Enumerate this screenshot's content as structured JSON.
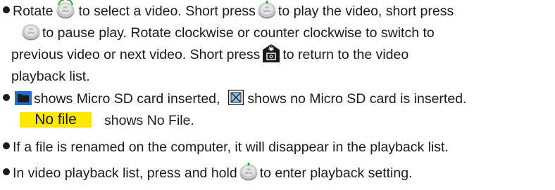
{
  "icons": {
    "knob": "rotary-knob-icon",
    "knob_rotate": "rotary-knob-rotate-icon",
    "home": "home-return-icon",
    "sd_inserted": "sd-card-inserted-icon",
    "sd_missing": "sd-card-missing-icon"
  },
  "colors": {
    "text": "#1a1a1a",
    "highlight": "#ffe800",
    "arrow_green": "#2fa52f"
  },
  "bullet1": {
    "l1_a": "Rotate",
    "l1_b": "to select a video. Short press",
    "l1_c": "to play the video, short press",
    "l2_b": "to pause play. Rotate clockwise or counter clockwise to switch to",
    "l3_a": "previous video or next video. Short press",
    "l3_b": "to return to the video",
    "l4": "playback list."
  },
  "bullet2": {
    "a": "shows Micro SD card inserted,",
    "b": "shows no Micro SD card is inserted.",
    "badge": "No file",
    "c": "shows No File."
  },
  "bullet3": {
    "text": "If a file is renamed on the computer, it will disappear in the playback list."
  },
  "bullet4": {
    "a": "In video playback list, press and hold",
    "b": "to enter playback setting."
  }
}
